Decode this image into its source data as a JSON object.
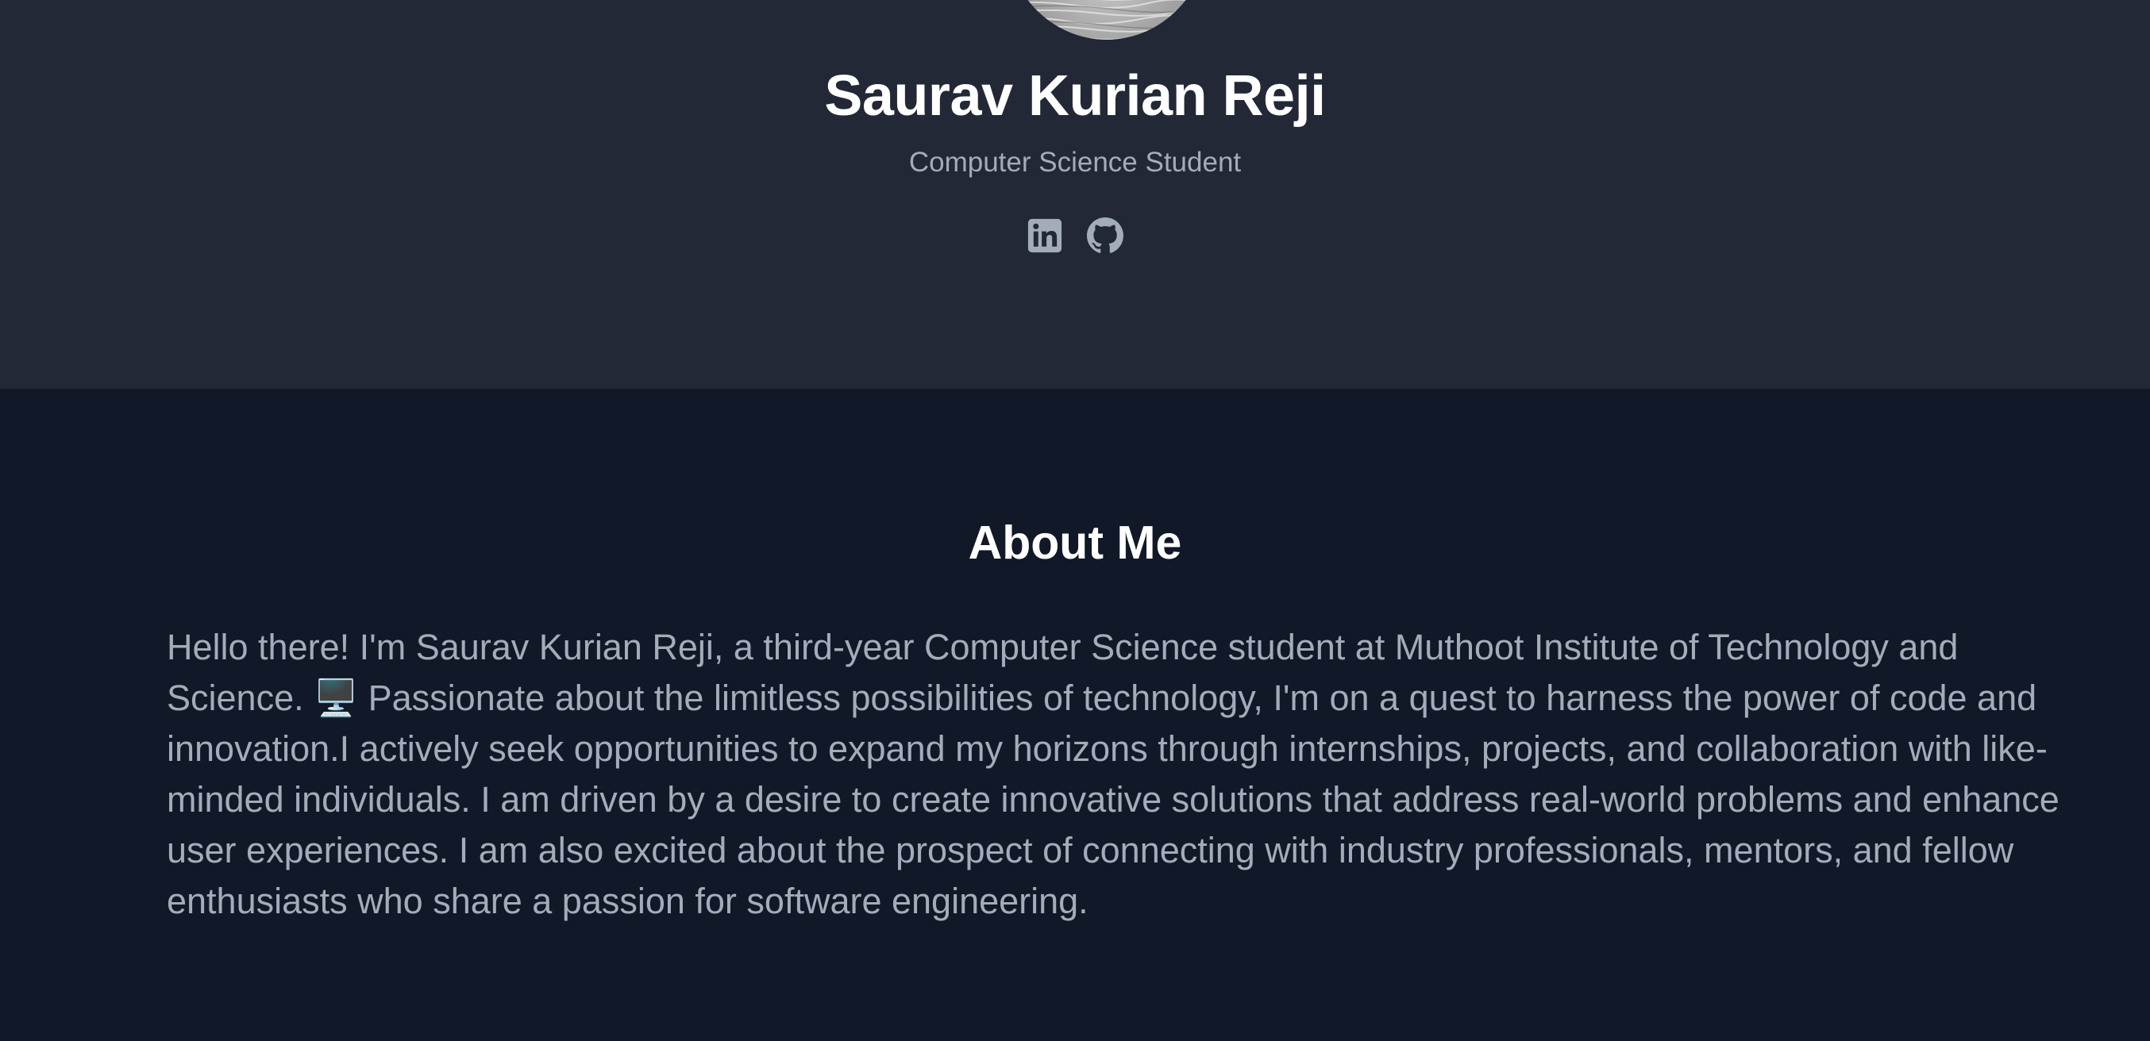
{
  "profile": {
    "name": "Saurav Kurian Reji",
    "subtitle": "Computer Science Student"
  },
  "social_links": [
    {
      "icon": "linkedin-icon",
      "color": "#a3acb9"
    },
    {
      "icon": "github-icon",
      "color": "#a3acb9"
    }
  ],
  "about": {
    "title": "About Me",
    "body": "Hello there! I'm Saurav Kurian Reji, a third-year Computer Science student at Muthoot Institute of Technology and Science. 🖥️ Passionate about the limitless possibilities of technology, I'm on a quest to harness the power of code and innovation.I actively seek opportunities to expand my horizons through internships, projects, and collaboration with like-minded individuals. I am driven by a desire to create innovative solutions that address real-world problems and enhance user experiences. I am also excited about the prospect of connecting with industry professionals, mentors, and fellow enthusiasts who share a passion for software engineering."
  },
  "colors": {
    "hero_background": "#222836",
    "page_background": "#111827",
    "heading": "#ffffff",
    "muted_text": "#a3acb9"
  }
}
